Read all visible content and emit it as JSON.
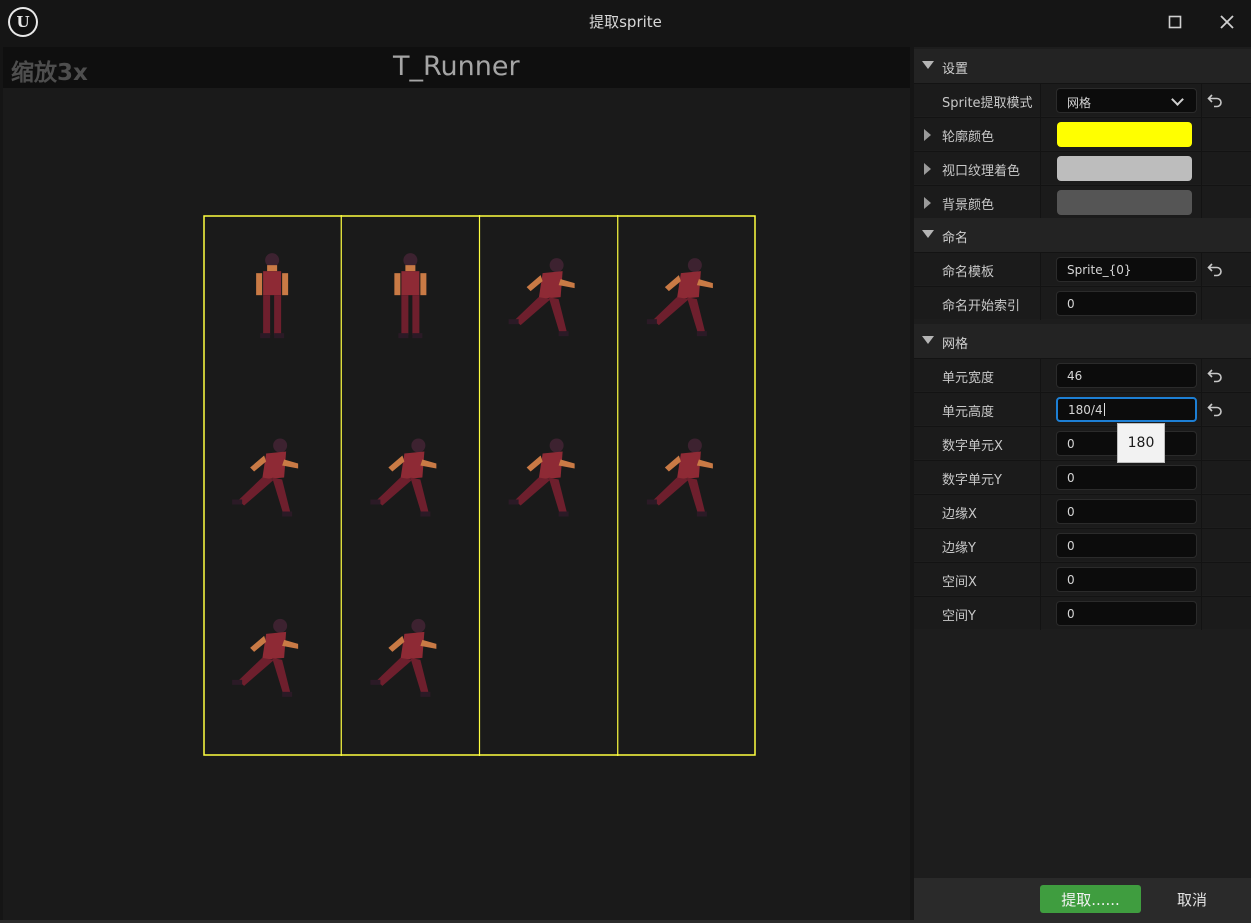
{
  "window": {
    "title": "提取sprite"
  },
  "viewport": {
    "zoom_label": "缩放3x",
    "asset_name": "T_Runner",
    "grid_line_color": "#ffff40"
  },
  "sprite_sheet": {
    "columns": 4,
    "rows": 3,
    "frames": [
      {
        "pose": "idle"
      },
      {
        "pose": "idle"
      },
      {
        "pose": "run"
      },
      {
        "pose": "run"
      },
      {
        "pose": "run"
      },
      {
        "pose": "run"
      },
      {
        "pose": "run"
      },
      {
        "pose": "run"
      },
      {
        "pose": "run"
      },
      {
        "pose": "run"
      }
    ]
  },
  "details": {
    "settings": {
      "label": "设置",
      "mode_label": "Sprite提取模式",
      "mode_value": "网格",
      "outline_color_label": "轮廓颜色",
      "outline_color": "#ffff00",
      "viewport_tint_label": "视口纹理着色",
      "viewport_tint": "#bdbdbd",
      "background_color_label": "背景颜色",
      "background_color": "#555555"
    },
    "naming": {
      "label": "命名",
      "template_label": "命名模板",
      "template_value": "Sprite_{0}",
      "start_index_label": "命名开始索引",
      "start_index_value": "0"
    },
    "grid": {
      "label": "网格",
      "cell_width_label": "单元宽度",
      "cell_width_value": "46",
      "cell_height_label": "单元高度",
      "cell_height_value": "180/4",
      "num_cells_x_label": "数字单元X",
      "num_cells_x_value": "0",
      "num_cells_y_label": "数字单元Y",
      "num_cells_y_value": "0",
      "margin_x_label": "边缘X",
      "margin_x_value": "0",
      "margin_y_label": "边缘Y",
      "margin_y_value": "0",
      "spacing_x_label": "空间X",
      "spacing_x_value": "0",
      "spacing_y_label": "空间Y",
      "spacing_y_value": "0"
    }
  },
  "tooltip": {
    "text": "180"
  },
  "footer": {
    "extract_label": "提取......",
    "cancel_label": "取消"
  },
  "icons": {
    "reset": "reset-arrow-icon",
    "maximize": "maximize-icon",
    "close": "close-icon"
  }
}
